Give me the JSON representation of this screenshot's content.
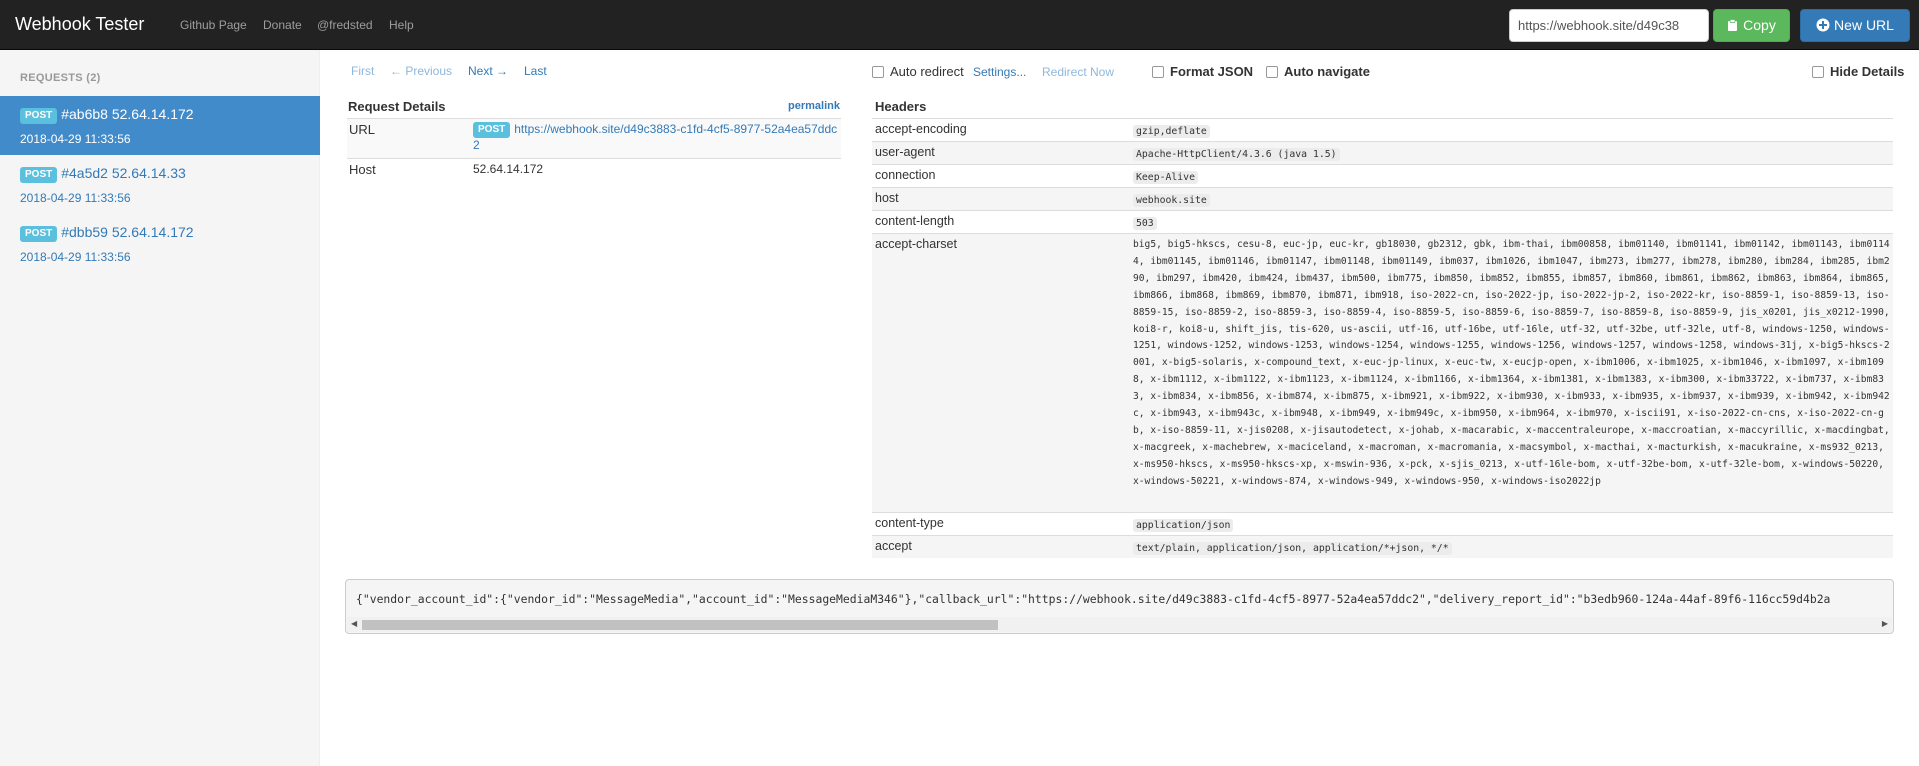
{
  "navbar": {
    "brand": "Webhook Tester",
    "links": [
      "Github Page",
      "Donate",
      "@fredsted",
      "Help"
    ],
    "url_value": "https://webhook.site/d49c38",
    "copy_label": "Copy",
    "new_url_label": "New URL"
  },
  "sidebar": {
    "header": "REQUESTS (2)",
    "requests": [
      {
        "method": "POST",
        "title": "#ab6b8 52.64.14.172",
        "date": "2018-04-29 11:33:56"
      },
      {
        "method": "POST",
        "title": "#4a5d2 52.64.14.33",
        "date": "2018-04-29 11:33:56"
      },
      {
        "method": "POST",
        "title": "#dbb59 52.64.14.172",
        "date": "2018-04-29 11:33:56"
      }
    ]
  },
  "pager": {
    "first": "First",
    "previous": "← Previous",
    "next": "Next →",
    "last": "Last"
  },
  "controls": {
    "auto_redirect": "Auto redirect",
    "settings": "Settings...",
    "redirect_now": "Redirect Now",
    "format_json": "Format JSON",
    "auto_navigate": "Auto navigate",
    "hide_details": "Hide Details"
  },
  "request_details": {
    "heading": "Request Details",
    "permalink": "permalink",
    "url_key": "URL",
    "url_method": "POST",
    "url_value": "https://webhook.site/d49c3883-c1fd-4cf5-8977-52a4ea57ddc2",
    "host_key": "Host",
    "host_value": "52.64.14.172"
  },
  "headers": {
    "heading": "Headers",
    "rows": [
      {
        "key": "accept-encoding",
        "value": "gzip,deflate"
      },
      {
        "key": "user-agent",
        "value": "Apache-HttpClient/4.3.6 (java 1.5)"
      },
      {
        "key": "connection",
        "value": "Keep-Alive"
      },
      {
        "key": "host",
        "value": "webhook.site"
      },
      {
        "key": "content-length",
        "value": "503"
      },
      {
        "key": "accept-charset",
        "value": "big5, big5-hkscs, cesu-8, euc-jp, euc-kr, gb18030, gb2312, gbk, ibm-thai, ibm00858, ibm01140, ibm01141, ibm01142, ibm01143, ibm01144, ibm01145, ibm01146, ibm01147, ibm01148, ibm01149, ibm037, ibm1026, ibm1047, ibm273, ibm277, ibm278, ibm280, ibm284, ibm285, ibm290, ibm297, ibm420, ibm424, ibm437, ibm500, ibm775, ibm850, ibm852, ibm855, ibm857, ibm860, ibm861, ibm862, ibm863, ibm864, ibm865, ibm866, ibm868, ibm869, ibm870, ibm871, ibm918, iso-2022-cn, iso-2022-jp, iso-2022-jp-2, iso-2022-kr, iso-8859-1, iso-8859-13, iso-8859-15, iso-8859-2, iso-8859-3, iso-8859-4, iso-8859-5, iso-8859-6, iso-8859-7, iso-8859-8, iso-8859-9, jis_x0201, jis_x0212-1990, koi8-r, koi8-u, shift_jis, tis-620, us-ascii, utf-16, utf-16be, utf-16le, utf-32, utf-32be, utf-32le, utf-8, windows-1250, windows-1251, windows-1252, windows-1253, windows-1254, windows-1255, windows-1256, windows-1257, windows-1258, windows-31j, x-big5-hkscs-2001, x-big5-solaris, x-compound_text, x-euc-jp-linux, x-euc-tw, x-eucjp-open, x-ibm1006, x-ibm1025, x-ibm1046, x-ibm1097, x-ibm1098, x-ibm1112, x-ibm1122, x-ibm1123, x-ibm1124, x-ibm1166, x-ibm1364, x-ibm1381, x-ibm1383, x-ibm300, x-ibm33722, x-ibm737, x-ibm833, x-ibm834, x-ibm856, x-ibm874, x-ibm875, x-ibm921, x-ibm922, x-ibm930, x-ibm933, x-ibm935, x-ibm937, x-ibm939, x-ibm942, x-ibm942c, x-ibm943, x-ibm943c, x-ibm948, x-ibm949, x-ibm949c, x-ibm950, x-ibm964, x-ibm970, x-iscii91, x-iso-2022-cn-cns, x-iso-2022-cn-gb, x-iso-8859-11, x-jis0208, x-jisautodetect, x-johab, x-macarabic, x-maccentraleurope, x-maccroatian, x-maccyrillic, x-macdingbat, x-macgreek, x-machebrew, x-maciceland, x-macroman, x-macromania, x-macsymbol, x-macthai, x-macturkish, x-macukraine, x-ms932_0213, x-ms950-hkscs, x-ms950-hkscs-xp, x-mswin-936, x-pck, x-sjis_0213, x-utf-16le-bom, x-utf-32be-bom, x-utf-32le-bom, x-windows-50220, x-windows-50221, x-windows-874, x-windows-949, x-windows-950, x-windows-iso2022jp"
      },
      {
        "key": "content-type",
        "value": "application/json"
      },
      {
        "key": "accept",
        "value": "text/plain, application/json, application/*+json, */*"
      }
    ]
  },
  "body": {
    "raw": "{\"vendor_account_id\":{\"vendor_id\":\"MessageMedia\",\"account_id\":\"MessageMediaM346\"},\"callback_url\":\"https://webhook.site/d49c3883-c1fd-4cf5-8977-52a4ea57ddc2\",\"delivery_report_id\":\"b3edb960-124a-44af-89f6-116cc59d4b2a"
  },
  "colors": {
    "navbar_bg": "#222222",
    "active_request_bg": "#428bca",
    "post_label": "#5bc0de",
    "copy_button": "#5cb85c",
    "new_url_button": "#337ab7"
  },
  "icons": [
    "clipboard-icon",
    "plus-circle-icon"
  ]
}
